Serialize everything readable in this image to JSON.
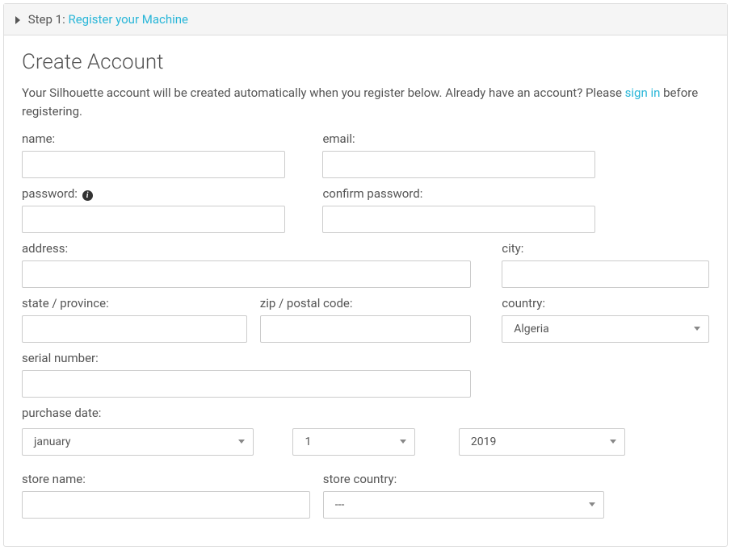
{
  "step": {
    "prefix": "Step 1:",
    "link": "Register your Machine"
  },
  "heading": "Create Account",
  "intro": {
    "before": "Your Silhouette account will be created automatically when you register below. Already have an account? Please ",
    "link": "sign in",
    "after": " before registering."
  },
  "labels": {
    "name": "name:",
    "email": "email:",
    "password": "password:",
    "confirm_password": "confirm password:",
    "address": "address:",
    "city": "city:",
    "state": "state / province:",
    "zip": "zip / postal code:",
    "country": "country:",
    "serial": "serial number:",
    "purchase_date": "purchase date:",
    "store_name": "store name:",
    "store_country": "store country:"
  },
  "values": {
    "country": "Algeria",
    "month": "january",
    "day": "1",
    "year": "2019",
    "store_country": "---"
  }
}
